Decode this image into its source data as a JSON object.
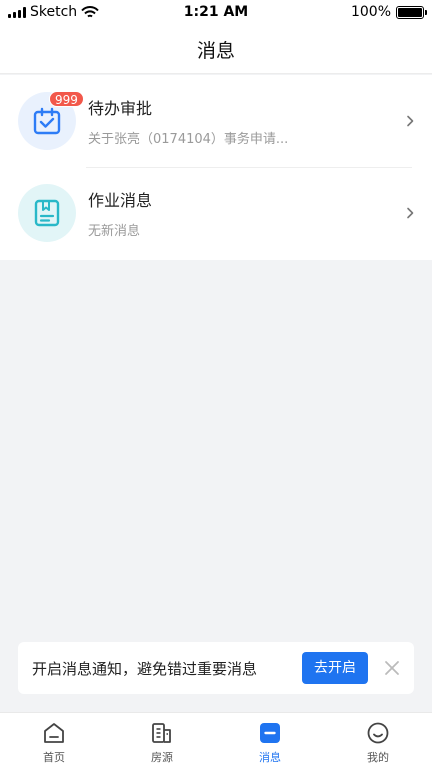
{
  "status_bar": {
    "carrier": "Sketch",
    "time": "1:21 AM",
    "battery": "100%",
    "battery_level": 1.0
  },
  "header": {
    "title": "消息"
  },
  "messages": [
    {
      "title": "待办审批",
      "subtitle": "关于张亮（0174104）事务申请...",
      "badge": "999",
      "icon": "calendar-check-icon",
      "icon_color": "#2d7cf6"
    },
    {
      "title": "作业消息",
      "subtitle": "无新消息",
      "icon": "document-bookmark-icon",
      "icon_color": "#29b8c8"
    }
  ],
  "notice": {
    "text": "开启消息通知，避免错过重要消息",
    "button_label": "去开启"
  },
  "tab_bar": {
    "active_color": "#1f74f0",
    "items": [
      {
        "label": "首页",
        "icon": "home-icon",
        "active": false
      },
      {
        "label": "房源",
        "icon": "building-icon",
        "active": false
      },
      {
        "label": "消息",
        "icon": "message-icon",
        "active": true
      },
      {
        "label": "我的",
        "icon": "smile-icon",
        "active": false
      }
    ]
  }
}
